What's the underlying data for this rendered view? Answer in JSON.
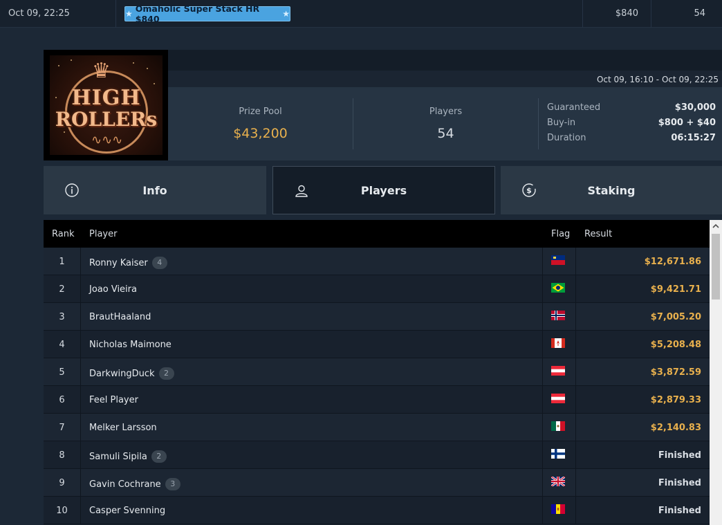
{
  "topbar": {
    "date": "Oct 09, 22:25",
    "tournament_name": "Omaholic Super Stack HR $840",
    "buyin": "$840",
    "players": "54"
  },
  "tournament": {
    "logo_line1": "HIGH",
    "logo_line2": "ROLLERs",
    "date_range": "Oct 09, 16:10 - Oct 09, 22:25",
    "prize_pool_label": "Prize Pool",
    "prize_pool": "$43,200",
    "players_label": "Players",
    "players": "54",
    "details": [
      {
        "key": "Guaranteed",
        "value": "$30,000"
      },
      {
        "key": "Buy-in",
        "value": "$800 + $40"
      },
      {
        "key": "Duration",
        "value": "06:15:27"
      }
    ]
  },
  "tabs": {
    "info": "Info",
    "players": "Players",
    "staking": "Staking"
  },
  "table": {
    "headers": {
      "rank": "Rank",
      "player": "Player",
      "flag": "Flag",
      "result": "Result"
    },
    "rows": [
      {
        "rank": "1",
        "player": "Ronny Kaiser",
        "entries": "4",
        "flag": "liechtenstein",
        "result": "$12,671.86",
        "money": true
      },
      {
        "rank": "2",
        "player": "Joao Vieira",
        "entries": "",
        "flag": "brazil",
        "result": "$9,421.71",
        "money": true
      },
      {
        "rank": "3",
        "player": "BrautHaaland",
        "entries": "",
        "flag": "norway",
        "result": "$7,005.20",
        "money": true
      },
      {
        "rank": "4",
        "player": "Nicholas Maimone",
        "entries": "",
        "flag": "canada",
        "result": "$5,208.48",
        "money": true
      },
      {
        "rank": "5",
        "player": "DarkwingDuck",
        "entries": "2",
        "flag": "austria",
        "result": "$3,872.59",
        "money": true
      },
      {
        "rank": "6",
        "player": "Feel Player",
        "entries": "",
        "flag": "austria",
        "result": "$2,879.33",
        "money": true
      },
      {
        "rank": "7",
        "player": "Melker Larsson",
        "entries": "",
        "flag": "mexico",
        "result": "$2,140.83",
        "money": true
      },
      {
        "rank": "8",
        "player": "Samuli Sipila",
        "entries": "2",
        "flag": "finland",
        "result": "Finished",
        "money": false
      },
      {
        "rank": "9",
        "player": "Gavin Cochrane",
        "entries": "3",
        "flag": "united-kingdom",
        "result": "Finished",
        "money": false
      },
      {
        "rank": "10",
        "player": "Casper Svenning",
        "entries": "",
        "flag": "andorra",
        "result": "Finished",
        "money": false
      }
    ]
  },
  "colors": {
    "accent_gold": "#e8b04d",
    "badge_blue": "#4aa3e0",
    "background": "#1c2836"
  }
}
